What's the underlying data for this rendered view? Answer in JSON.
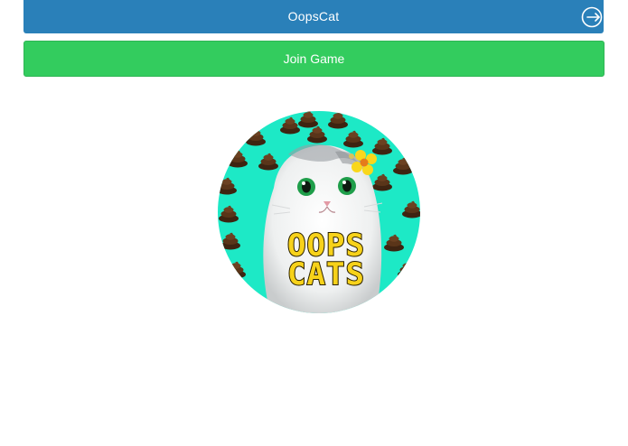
{
  "header": {
    "title": "OopsCat"
  },
  "actions": {
    "join_label": "Join Game"
  },
  "avatar": {
    "logo_line1": "OOPS",
    "logo_line2": "CATS"
  },
  "colors": {
    "header_bg": "#2a80b9",
    "join_bg": "#33cc5e",
    "avatar_bg": "#1de9c6",
    "logo_yellow": "#f7d21a"
  }
}
